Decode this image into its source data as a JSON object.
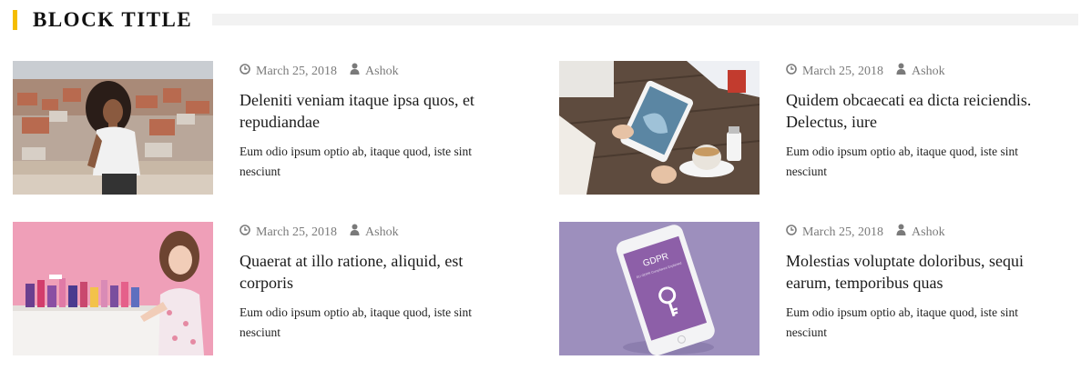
{
  "block": {
    "title": "BLOCK TITLE",
    "accent_color": "#f5bd00"
  },
  "posts": [
    {
      "date": "March 25, 2018",
      "author": "Ashok",
      "title": "Deleniti veniam itaque ipsa quos, et repudiandae",
      "excerpt": "Eum odio ipsum optio ab, itaque quod, iste sint nesciunt"
    },
    {
      "date": "March 25, 2018",
      "author": "Ashok",
      "title": "Quidem obcaecati ea dicta reiciendis. Delectus, iure",
      "excerpt": "Eum odio ipsum optio ab, itaque quod, iste sint nesciunt"
    },
    {
      "date": "March 25, 2018",
      "author": "Ashok",
      "title": "Quaerat at illo ratione, aliquid, est corporis",
      "excerpt": "Eum odio ipsum optio ab, itaque quod, iste sint nesciunt"
    },
    {
      "date": "March 25, 2018",
      "author": "Ashok",
      "title": "Molestias voluptate doloribus, sequi earum, temporibus quas",
      "excerpt": "Eum odio ipsum optio ab, itaque quod, iste sint nesciunt"
    }
  ],
  "phone_screen": {
    "heading": "GDPR",
    "subtext": "EU GDPR Compliance Explained"
  },
  "icons": {
    "date": "clock-icon",
    "author": "user-icon"
  }
}
